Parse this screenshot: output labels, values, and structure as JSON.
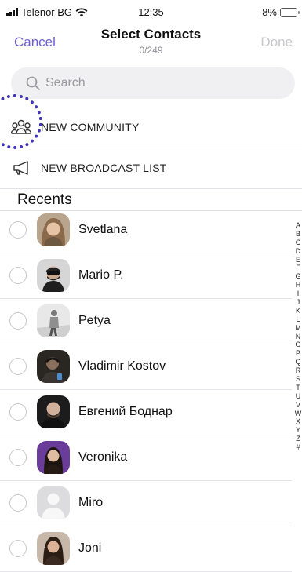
{
  "status_bar": {
    "carrier": "Telenor BG",
    "time": "12:35",
    "battery": "8%",
    "battery_level": 0.08
  },
  "nav": {
    "cancel_label": "Cancel",
    "title": "Select Contacts",
    "count": "0/249",
    "done_label": "Done"
  },
  "search": {
    "placeholder": "Search"
  },
  "actions": [
    {
      "label": "NEW COMMUNITY",
      "icon": "community-icon"
    },
    {
      "label": "NEW BROADCAST LIST",
      "icon": "megaphone-icon"
    }
  ],
  "section_title": "Recents",
  "contacts": [
    {
      "name": "Svetlana",
      "avatar": "photo-avatar"
    },
    {
      "name": "Mario P.",
      "avatar": "photo-avatar"
    },
    {
      "name": "Petya",
      "avatar": "photo-avatar"
    },
    {
      "name": "Vladimir Kostov",
      "avatar": "photo-avatar"
    },
    {
      "name": "Евгений Боднар",
      "avatar": "photo-avatar"
    },
    {
      "name": "Veronika",
      "avatar": "photo-avatar"
    },
    {
      "name": "Miro",
      "avatar": "placeholder-avatar"
    },
    {
      "name": "Joni",
      "avatar": "photo-avatar"
    }
  ],
  "alphabet_index": [
    "A",
    "B",
    "C",
    "D",
    "E",
    "F",
    "G",
    "H",
    "I",
    "J",
    "K",
    "L",
    "M",
    "N",
    "O",
    "P",
    "Q",
    "R",
    "S",
    "T",
    "U",
    "V",
    "W",
    "X",
    "Y",
    "Z",
    "#"
  ],
  "colors": {
    "accent": "#6c5fd2",
    "highlight_ring": "#3f33b8",
    "disabled": "#c7c7cc"
  }
}
